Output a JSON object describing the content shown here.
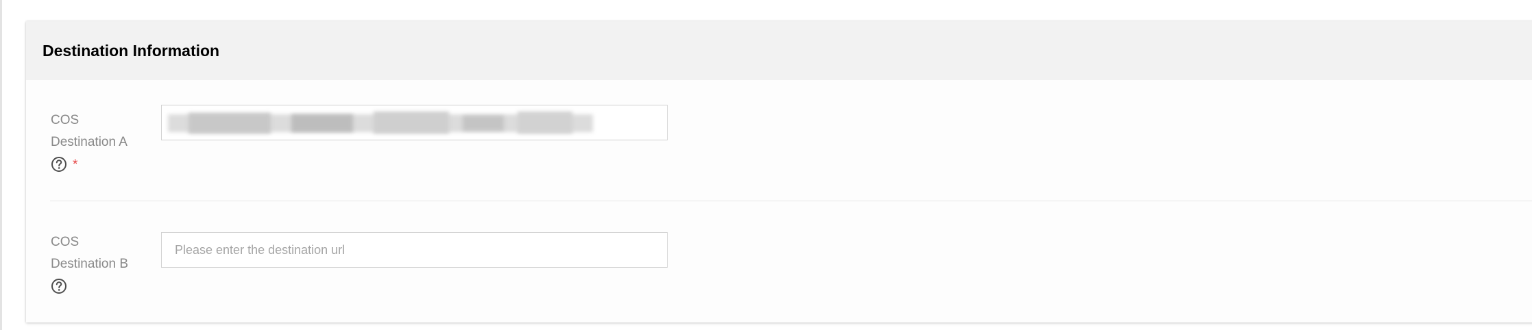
{
  "section": {
    "title": "Destination Information"
  },
  "fields": [
    {
      "label_line1": "COS",
      "label_line2": "Destination A",
      "required_mark": "*",
      "value": "",
      "value_redacted": true,
      "placeholder": ""
    },
    {
      "label_line1": "COS",
      "label_line2": "Destination B",
      "required_mark": "",
      "value": "",
      "value_redacted": false,
      "placeholder": "Please enter the destination url"
    }
  ],
  "icons": {
    "help": "question-circle-icon"
  },
  "colors": {
    "header_bg": "#f2f2f2",
    "label": "#888888",
    "required": "#e54545",
    "input_border": "#d1d1d1",
    "placeholder": "#a6a6a6"
  }
}
